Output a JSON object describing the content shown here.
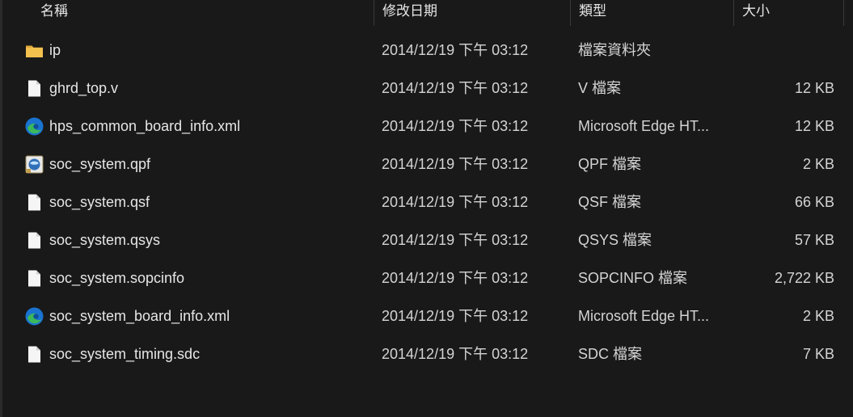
{
  "header": {
    "name": "名稱",
    "date": "修改日期",
    "type": "類型",
    "size": "大小"
  },
  "files": [
    {
      "name": "ip",
      "date": "2014/12/19 下午 03:12",
      "type": "檔案資料夾",
      "size": "",
      "icon": "folder-icon"
    },
    {
      "name": "ghrd_top.v",
      "date": "2014/12/19 下午 03:12",
      "type": "V 檔案",
      "size": "12 KB",
      "icon": "file-icon"
    },
    {
      "name": "hps_common_board_info.xml",
      "date": "2014/12/19 下午 03:12",
      "type": "Microsoft Edge HT...",
      "size": "12 KB",
      "icon": "edge-icon"
    },
    {
      "name": "soc_system.qpf",
      "date": "2014/12/19 下午 03:12",
      "type": "QPF 檔案",
      "size": "2 KB",
      "icon": "quartus-project-icon"
    },
    {
      "name": "soc_system.qsf",
      "date": "2014/12/19 下午 03:12",
      "type": "QSF 檔案",
      "size": "66 KB",
      "icon": "file-icon"
    },
    {
      "name": "soc_system.qsys",
      "date": "2014/12/19 下午 03:12",
      "type": "QSYS 檔案",
      "size": "57 KB",
      "icon": "file-icon"
    },
    {
      "name": "soc_system.sopcinfo",
      "date": "2014/12/19 下午 03:12",
      "type": "SOPCINFO 檔案",
      "size": "2,722 KB",
      "icon": "file-icon"
    },
    {
      "name": "soc_system_board_info.xml",
      "date": "2014/12/19 下午 03:12",
      "type": "Microsoft Edge HT...",
      "size": "2 KB",
      "icon": "edge-icon"
    },
    {
      "name": "soc_system_timing.sdc",
      "date": "2014/12/19 下午 03:12",
      "type": "SDC 檔案",
      "size": "7 KB",
      "icon": "file-icon"
    }
  ],
  "colors": {
    "background": "#191919",
    "text": "#e6e6e6",
    "folder": "#f2c14e",
    "edge_blue": "#1a73d0",
    "edge_green": "#3bb85c"
  }
}
